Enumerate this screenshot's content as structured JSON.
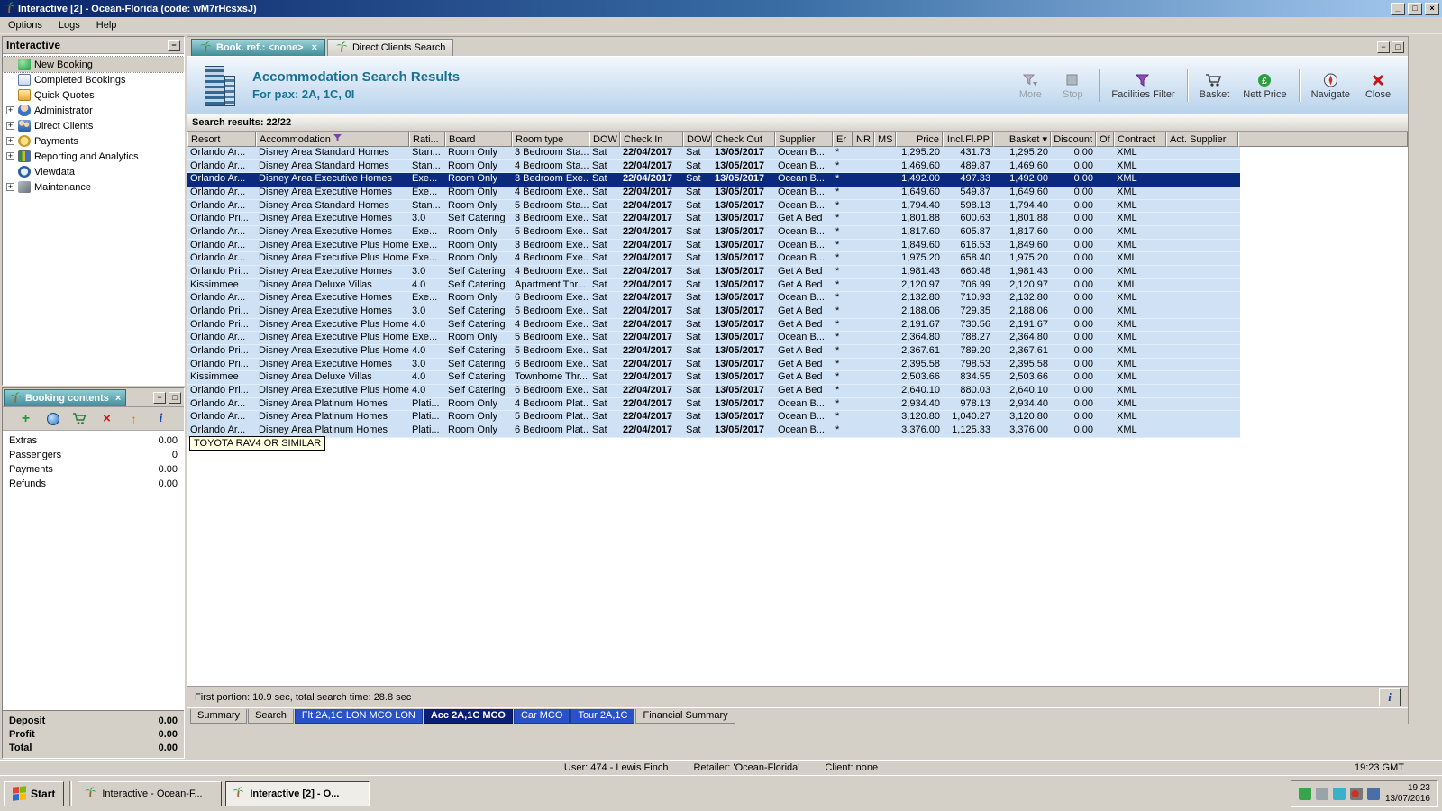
{
  "window": {
    "title": "Interactive [2] - Ocean-Florida (code: wM7rHcsxsJ)",
    "menu": [
      "Options",
      "Logs",
      "Help"
    ],
    "buttons": {
      "minimize": "_",
      "maximize": "□",
      "close": "×"
    }
  },
  "sidebar": {
    "title": "Interactive",
    "items": [
      {
        "label": "New Booking",
        "icon": "new-booking-icon",
        "expandable": false,
        "selected": true
      },
      {
        "label": "Completed Bookings",
        "icon": "completed-bookings-icon",
        "expandable": false
      },
      {
        "label": "Quick Quotes",
        "icon": "quick-quotes-icon",
        "expandable": false
      },
      {
        "label": "Administrator",
        "icon": "administrator-icon",
        "expandable": true
      },
      {
        "label": "Direct Clients",
        "icon": "direct-clients-icon",
        "expandable": true
      },
      {
        "label": "Payments",
        "icon": "payments-icon",
        "expandable": true
      },
      {
        "label": "Reporting and Analytics",
        "icon": "reporting-icon",
        "expandable": true
      },
      {
        "label": "Viewdata",
        "icon": "viewdata-icon",
        "expandable": false
      },
      {
        "label": "Maintenance",
        "icon": "maintenance-icon",
        "expandable": true
      }
    ]
  },
  "booking_contents": {
    "title": "Booking contents",
    "toolbar_icons": [
      "add-icon",
      "globe-icon",
      "add-to-basket-icon",
      "delete-icon",
      "promote-icon",
      "info-icon"
    ],
    "rows": [
      {
        "label": "Extras",
        "value": "0.00"
      },
      {
        "label": "Passengers",
        "value": "0"
      },
      {
        "label": "Payments",
        "value": "0.00"
      },
      {
        "label": "Refunds",
        "value": "0.00"
      }
    ],
    "totals": [
      {
        "label": "Deposit",
        "value": "0.00"
      },
      {
        "label": "Profit",
        "value": "0.00"
      },
      {
        "label": "Total",
        "value": "0.00"
      }
    ]
  },
  "document_tabs": [
    {
      "label": "Book. ref.: <none>",
      "active": true,
      "closable": true
    },
    {
      "label": "Direct Clients Search",
      "active": false,
      "closable": false
    }
  ],
  "header": {
    "title": "Accommodation Search Results",
    "subtitle": "For pax: 2A, 1C, 0I",
    "toolbar": [
      {
        "label": "More",
        "icon": "more-filter-icon",
        "disabled": true
      },
      {
        "label": "Stop",
        "icon": "stop-icon",
        "disabled": true
      },
      {
        "label": "Facilities Filter",
        "icon": "facilities-filter-icon",
        "disabled": false
      },
      {
        "label": "Basket",
        "icon": "basket-icon",
        "disabled": false
      },
      {
        "label": "Nett Price",
        "icon": "nett-price-icon",
        "disabled": false
      },
      {
        "label": "Navigate",
        "icon": "navigate-icon",
        "disabled": false
      },
      {
        "label": "Close",
        "icon": "close-icon",
        "disabled": false
      }
    ]
  },
  "results": {
    "summary": "Search results: 22/22"
  },
  "results_table": {
    "columns": [
      "Resort",
      "Accommodation",
      "Rati...",
      "Board",
      "Room type",
      "DOW",
      "Check In",
      "DOW",
      "Check Out",
      "Supplier",
      "Er",
      "NR",
      "MS",
      "Price",
      "Incl.Fl.PP",
      "Basket",
      "Discount",
      "Of",
      "Contract",
      "Act. Supplier"
    ],
    "selected_index": 2,
    "rows": [
      [
        "Orlando Ar...",
        "Disney Area Standard Homes",
        "Stan...",
        "Room Only",
        "3 Bedroom Sta...",
        "Sat",
        "22/04/2017",
        "Sat",
        "13/05/2017",
        "Ocean B...",
        "*",
        "",
        "",
        "1,295.20",
        "431.73",
        "1,295.20",
        "0.00",
        "",
        "XML",
        ""
      ],
      [
        "Orlando Ar...",
        "Disney Area Standard Homes",
        "Stan...",
        "Room Only",
        "4 Bedroom Sta...",
        "Sat",
        "22/04/2017",
        "Sat",
        "13/05/2017",
        "Ocean B...",
        "*",
        "",
        "",
        "1,469.60",
        "489.87",
        "1,469.60",
        "0.00",
        "",
        "XML",
        ""
      ],
      [
        "Orlando Ar...",
        "Disney Area Executive Homes",
        "Exe...",
        "Room Only",
        "3 Bedroom Exe...",
        "Sat",
        "22/04/2017",
        "Sat",
        "13/05/2017",
        "Ocean B...",
        "*",
        "",
        "",
        "1,492.00",
        "497.33",
        "1,492.00",
        "0.00",
        "",
        "XML",
        ""
      ],
      [
        "Orlando Ar...",
        "Disney Area Executive Homes",
        "Exe...",
        "Room Only",
        "4 Bedroom Exe...",
        "Sat",
        "22/04/2017",
        "Sat",
        "13/05/2017",
        "Ocean B...",
        "*",
        "",
        "",
        "1,649.60",
        "549.87",
        "1,649.60",
        "0.00",
        "",
        "XML",
        ""
      ],
      [
        "Orlando Ar...",
        "Disney Area Standard Homes",
        "Stan...",
        "Room Only",
        "5 Bedroom Sta...",
        "Sat",
        "22/04/2017",
        "Sat",
        "13/05/2017",
        "Ocean B...",
        "*",
        "",
        "",
        "1,794.40",
        "598.13",
        "1,794.40",
        "0.00",
        "",
        "XML",
        ""
      ],
      [
        "Orlando Pri...",
        "Disney Area Executive Homes",
        "3.0",
        "Self Catering",
        "3 Bedroom Exe...",
        "Sat",
        "22/04/2017",
        "Sat",
        "13/05/2017",
        "Get A Bed",
        "*",
        "",
        "",
        "1,801.88",
        "600.63",
        "1,801.88",
        "0.00",
        "",
        "XML",
        ""
      ],
      [
        "Orlando Ar...",
        "Disney Area Executive Homes",
        "Exe...",
        "Room Only",
        "5 Bedroom Exe...",
        "Sat",
        "22/04/2017",
        "Sat",
        "13/05/2017",
        "Ocean B...",
        "*",
        "",
        "",
        "1,817.60",
        "605.87",
        "1,817.60",
        "0.00",
        "",
        "XML",
        ""
      ],
      [
        "Orlando Ar...",
        "Disney Area Executive Plus Homes",
        "Exe...",
        "Room Only",
        "3 Bedroom Exe...",
        "Sat",
        "22/04/2017",
        "Sat",
        "13/05/2017",
        "Ocean B...",
        "*",
        "",
        "",
        "1,849.60",
        "616.53",
        "1,849.60",
        "0.00",
        "",
        "XML",
        ""
      ],
      [
        "Orlando Ar...",
        "Disney Area Executive Plus Homes",
        "Exe...",
        "Room Only",
        "4 Bedroom Exe...",
        "Sat",
        "22/04/2017",
        "Sat",
        "13/05/2017",
        "Ocean B...",
        "*",
        "",
        "",
        "1,975.20",
        "658.40",
        "1,975.20",
        "0.00",
        "",
        "XML",
        ""
      ],
      [
        "Orlando Pri...",
        "Disney Area Executive Homes",
        "3.0",
        "Self Catering",
        "4 Bedroom Exe...",
        "Sat",
        "22/04/2017",
        "Sat",
        "13/05/2017",
        "Get A Bed",
        "*",
        "",
        "",
        "1,981.43",
        "660.48",
        "1,981.43",
        "0.00",
        "",
        "XML",
        ""
      ],
      [
        "Kissimmee",
        "Disney Area Deluxe Villas",
        "4.0",
        "Self Catering",
        "Apartment Thr...",
        "Sat",
        "22/04/2017",
        "Sat",
        "13/05/2017",
        "Get A Bed",
        "*",
        "",
        "",
        "2,120.97",
        "706.99",
        "2,120.97",
        "0.00",
        "",
        "XML",
        ""
      ],
      [
        "Orlando Ar...",
        "Disney Area Executive Homes",
        "Exe...",
        "Room Only",
        "6 Bedroom Exe...",
        "Sat",
        "22/04/2017",
        "Sat",
        "13/05/2017",
        "Ocean B...",
        "*",
        "",
        "",
        "2,132.80",
        "710.93",
        "2,132.80",
        "0.00",
        "",
        "XML",
        ""
      ],
      [
        "Orlando Pri...",
        "Disney Area Executive Homes",
        "3.0",
        "Self Catering",
        "5 Bedroom Exe...",
        "Sat",
        "22/04/2017",
        "Sat",
        "13/05/2017",
        "Get A Bed",
        "*",
        "",
        "",
        "2,188.06",
        "729.35",
        "2,188.06",
        "0.00",
        "",
        "XML",
        ""
      ],
      [
        "Orlando Pri...",
        "Disney Area Executive Plus Homes",
        "4.0",
        "Self Catering",
        "4 Bedroom Exe...",
        "Sat",
        "22/04/2017",
        "Sat",
        "13/05/2017",
        "Get A Bed",
        "*",
        "",
        "",
        "2,191.67",
        "730.56",
        "2,191.67",
        "0.00",
        "",
        "XML",
        ""
      ],
      [
        "Orlando Ar...",
        "Disney Area Executive Plus Homes",
        "Exe...",
        "Room Only",
        "5 Bedroom Exe...",
        "Sat",
        "22/04/2017",
        "Sat",
        "13/05/2017",
        "Ocean B...",
        "*",
        "",
        "",
        "2,364.80",
        "788.27",
        "2,364.80",
        "0.00",
        "",
        "XML",
        ""
      ],
      [
        "Orlando Pri...",
        "Disney Area Executive Plus Homes",
        "4.0",
        "Self Catering",
        "5 Bedroom Exe...",
        "Sat",
        "22/04/2017",
        "Sat",
        "13/05/2017",
        "Get A Bed",
        "*",
        "",
        "",
        "2,367.61",
        "789.20",
        "2,367.61",
        "0.00",
        "",
        "XML",
        ""
      ],
      [
        "Orlando Pri...",
        "Disney Area Executive Homes",
        "3.0",
        "Self Catering",
        "6 Bedroom Exe...",
        "Sat",
        "22/04/2017",
        "Sat",
        "13/05/2017",
        "Get A Bed",
        "*",
        "",
        "",
        "2,395.58",
        "798.53",
        "2,395.58",
        "0.00",
        "",
        "XML",
        ""
      ],
      [
        "Kissimmee",
        "Disney Area Deluxe Villas",
        "4.0",
        "Self Catering",
        "Townhome Thr...",
        "Sat",
        "22/04/2017",
        "Sat",
        "13/05/2017",
        "Get A Bed",
        "*",
        "",
        "",
        "2,503.66",
        "834.55",
        "2,503.66",
        "0.00",
        "",
        "XML",
        ""
      ],
      [
        "Orlando Pri...",
        "Disney Area Executive Plus Homes",
        "4.0",
        "Self Catering",
        "6 Bedroom Exe...",
        "Sat",
        "22/04/2017",
        "Sat",
        "13/05/2017",
        "Get A Bed",
        "*",
        "",
        "",
        "2,640.10",
        "880.03",
        "2,640.10",
        "0.00",
        "",
        "XML",
        ""
      ],
      [
        "Orlando Ar...",
        "Disney Area Platinum Homes",
        "Plati...",
        "Room Only",
        "4 Bedroom Plat...",
        "Sat",
        "22/04/2017",
        "Sat",
        "13/05/2017",
        "Ocean B...",
        "*",
        "",
        "",
        "2,934.40",
        "978.13",
        "2,934.40",
        "0.00",
        "",
        "XML",
        ""
      ],
      [
        "Orlando Ar...",
        "Disney Area Platinum Homes",
        "Plati...",
        "Room Only",
        "5 Bedroom Plat...",
        "Sat",
        "22/04/2017",
        "Sat",
        "13/05/2017",
        "Ocean B...",
        "*",
        "",
        "",
        "3,120.80",
        "1,040.27",
        "3,120.80",
        "0.00",
        "",
        "XML",
        ""
      ],
      [
        "Orlando Ar...",
        "Disney Area Platinum Homes",
        "Plati...",
        "Room Only",
        "6 Bedroom Plat...",
        "Sat",
        "22/04/2017",
        "Sat",
        "13/05/2017",
        "Ocean B...",
        "*",
        "",
        "",
        "3,376.00",
        "1,125.33",
        "3,376.00",
        "0.00",
        "",
        "XML",
        ""
      ]
    ]
  },
  "tooltip": "TOYOTA RAV4 OR SIMILAR",
  "status_line": "First portion: 10.9 sec, total search time: 28.8 sec",
  "bottom_tabs": [
    {
      "label": "Summary",
      "style": "plain",
      "active": false
    },
    {
      "label": "Search",
      "style": "plain",
      "active": false
    },
    {
      "label": "Flt 2A,1C LON MCO LON",
      "style": "blue",
      "active": false
    },
    {
      "label": "Acc 2A,1C MCO",
      "style": "navy",
      "active": true
    },
    {
      "label": "Car MCO",
      "style": "blue",
      "active": false
    },
    {
      "label": "Tour 2A,1C",
      "style": "blue",
      "active": false
    },
    {
      "label": "Financial Summary",
      "style": "plain",
      "active": false
    }
  ],
  "status_bar": {
    "user": "User: 474 - Lewis Finch",
    "retailer": "Retailer: 'Ocean-Florida'",
    "client": "Client: none",
    "time": "19:23 GMT"
  },
  "taskbar": {
    "start": "Start",
    "windows": [
      {
        "label": "Interactive - Ocean-F...",
        "active": false
      },
      {
        "label": "Interactive [2] - O...",
        "active": true
      }
    ],
    "tray_icons": [
      "tray-mail-icon",
      "tray-print-icon",
      "tray-network-icon",
      "tray-audio-icon",
      "tray-display-icon"
    ],
    "tray_time": "19:23",
    "tray_date": "13/07/2016"
  },
  "colors": {
    "titlebar": "#0a246a",
    "chrome": "#d4d0c8",
    "row_bg": "#cfe2f5",
    "selected_row": "#0b2a7e",
    "active_tab_teal": "#3f8d99",
    "tab_blue": "#2a52c8",
    "tab_navy": "#0a1e75",
    "header_text": "#1a7292"
  }
}
